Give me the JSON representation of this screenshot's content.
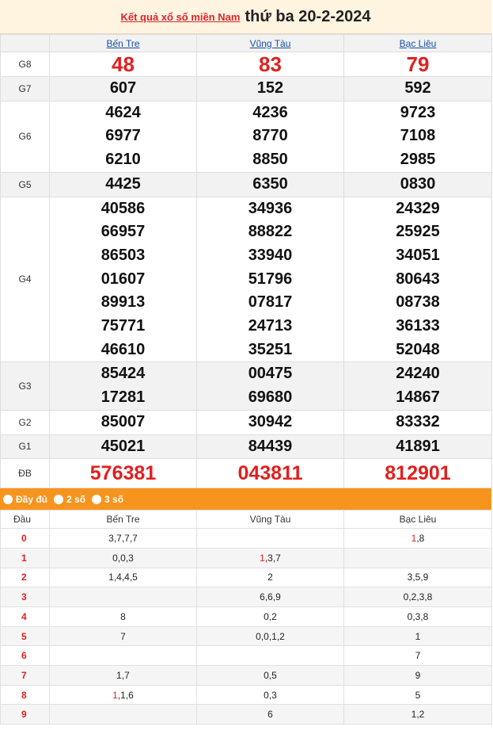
{
  "title": {
    "link": "Kết quả xổ số miền Nam",
    "date": "thứ ba 20-2-2024"
  },
  "provinces": [
    "Bến Tre",
    "Vũng Tàu",
    "Bạc Liêu"
  ],
  "prizes": [
    {
      "label": "G8",
      "values": [
        [
          "48"
        ],
        [
          "83"
        ],
        [
          "79"
        ]
      ]
    },
    {
      "label": "G7",
      "values": [
        [
          "607"
        ],
        [
          "152"
        ],
        [
          "592"
        ]
      ]
    },
    {
      "label": "G6",
      "values": [
        [
          "4624",
          "6977",
          "6210"
        ],
        [
          "4236",
          "8770",
          "8850"
        ],
        [
          "9723",
          "7108",
          "2985"
        ]
      ]
    },
    {
      "label": "G5",
      "values": [
        [
          "4425"
        ],
        [
          "6350"
        ],
        [
          "0830"
        ]
      ]
    },
    {
      "label": "G4",
      "values": [
        [
          "40586",
          "66957",
          "86503",
          "01607",
          "89913",
          "75771",
          "46610"
        ],
        [
          "34936",
          "88822",
          "33940",
          "51796",
          "07817",
          "24713",
          "35251"
        ],
        [
          "24329",
          "25925",
          "34051",
          "80643",
          "08738",
          "36133",
          "52048"
        ]
      ]
    },
    {
      "label": "G3",
      "values": [
        [
          "85424",
          "17281"
        ],
        [
          "00475",
          "69680"
        ],
        [
          "24240",
          "14867"
        ]
      ]
    },
    {
      "label": "G2",
      "values": [
        [
          "85007"
        ],
        [
          "30942"
        ],
        [
          "83332"
        ]
      ]
    },
    {
      "label": "G1",
      "values": [
        [
          "45021"
        ],
        [
          "84439"
        ],
        [
          "41891"
        ]
      ]
    },
    {
      "label": "ĐB",
      "values": [
        [
          "576381"
        ],
        [
          "043811"
        ],
        [
          "812901"
        ]
      ]
    }
  ],
  "tabs": [
    "Đầy đủ",
    "2 số",
    "3 số"
  ],
  "dau": {
    "header": "Đầu",
    "rows": [
      {
        "key": "0",
        "cells": [
          {
            "lead": "",
            "rest": "3,7,7,7"
          },
          {
            "lead": "",
            "rest": ""
          },
          {
            "lead": "1",
            "rest": ",8"
          }
        ]
      },
      {
        "key": "1",
        "cells": [
          {
            "lead": "",
            "rest": "0,0,3"
          },
          {
            "lead": "1",
            "rest": ",3,7"
          },
          {
            "lead": "",
            "rest": ""
          }
        ]
      },
      {
        "key": "2",
        "cells": [
          {
            "lead": "",
            "rest": "1,4,4,5"
          },
          {
            "lead": "",
            "rest": "2"
          },
          {
            "lead": "",
            "rest": "3,5,9"
          }
        ]
      },
      {
        "key": "3",
        "cells": [
          {
            "lead": "",
            "rest": ""
          },
          {
            "lead": "",
            "rest": "6,6,9"
          },
          {
            "lead": "",
            "rest": "0,2,3,8"
          }
        ]
      },
      {
        "key": "4",
        "cells": [
          {
            "lead": "",
            "rest": "8"
          },
          {
            "lead": "",
            "rest": "0,2"
          },
          {
            "lead": "",
            "rest": "0,3,8"
          }
        ]
      },
      {
        "key": "5",
        "cells": [
          {
            "lead": "",
            "rest": "7"
          },
          {
            "lead": "",
            "rest": "0,0,1,2"
          },
          {
            "lead": "",
            "rest": "1"
          }
        ]
      },
      {
        "key": "6",
        "cells": [
          {
            "lead": "",
            "rest": ""
          },
          {
            "lead": "",
            "rest": ""
          },
          {
            "lead": "",
            "rest": "7"
          }
        ]
      },
      {
        "key": "7",
        "cells": [
          {
            "lead": "",
            "rest": "1,7"
          },
          {
            "lead": "",
            "rest": "0,5"
          },
          {
            "lead": "",
            "rest": "9"
          }
        ]
      },
      {
        "key": "8",
        "cells": [
          {
            "lead": "1",
            "rest": ",1,6"
          },
          {
            "lead": "",
            "rest": "0,3"
          },
          {
            "lead": "",
            "rest": "5"
          }
        ]
      },
      {
        "key": "9",
        "cells": [
          {
            "lead": "",
            "rest": ""
          },
          {
            "lead": "",
            "rest": "6"
          },
          {
            "lead": "",
            "rest": "1,2"
          }
        ]
      }
    ]
  },
  "colors": {
    "accent": "#f7941d",
    "prize_red": "#e02020",
    "link_blue": "#1a4fa8"
  }
}
